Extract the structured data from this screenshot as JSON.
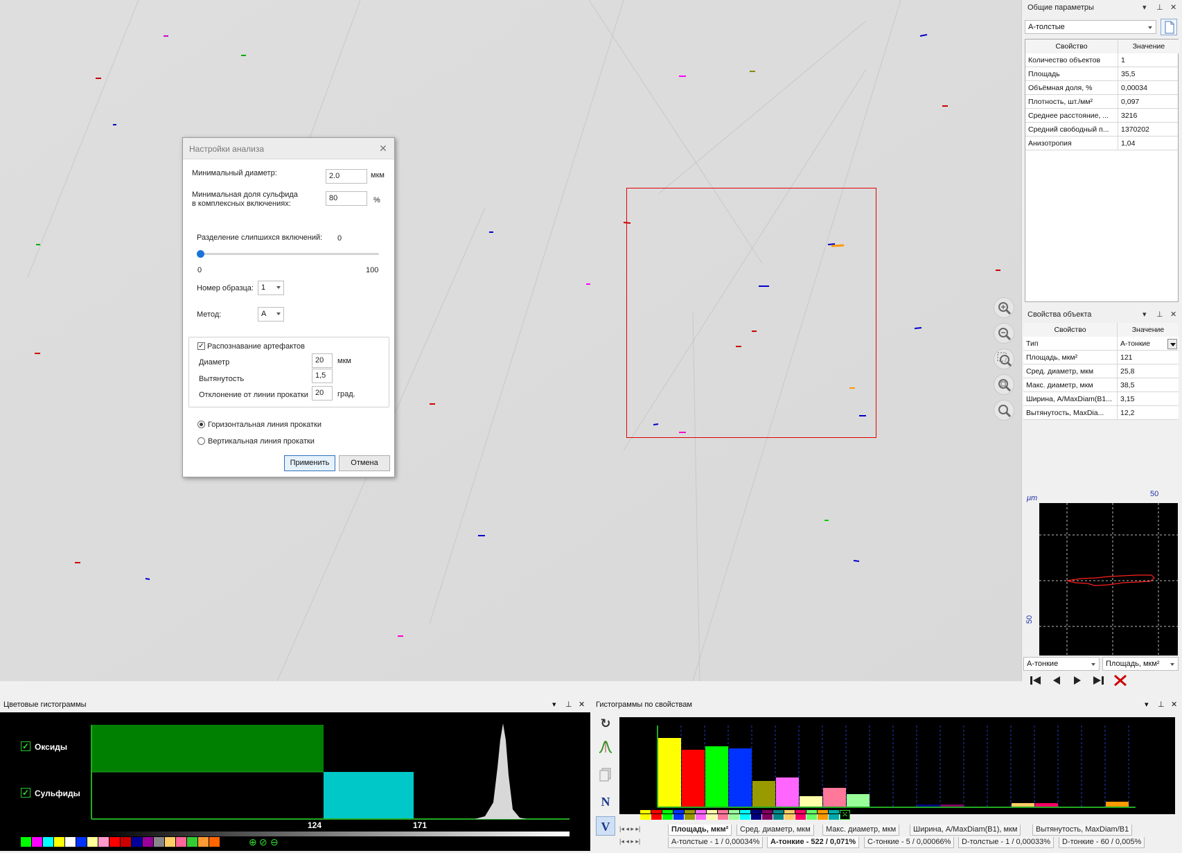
{
  "dialog": {
    "title": "Настройки анализа",
    "min_diameter_label": "Минимальный диаметр:",
    "min_diameter_value": "2.0",
    "min_diameter_unit": "мкм",
    "sulfide_fraction_label_1": "Минимальная доля сульфида",
    "sulfide_fraction_label_2": "в комплексных включениях:",
    "sulfide_fraction_value": "80",
    "sulfide_fraction_unit": "%",
    "separation_label": "Разделение слипшихся включений:",
    "separation_value": "0",
    "slider_min": "0",
    "slider_max": "100",
    "sample_label": "Номер образца:",
    "sample_value": "1",
    "method_label": "Метод:",
    "method_value": "A",
    "artifacts_label": "Распознавание артефактов",
    "artifacts_checked": true,
    "diameter_label": "Диаметр",
    "diameter_value": "20",
    "diameter_unit": "мкм",
    "elongation_label": "Вытянутость",
    "elongation_value": "1,5",
    "deviation_label": "Отклонение от линии прокатки",
    "deviation_value": "20",
    "deviation_unit": "град.",
    "radio_horizontal": "Горизонтальная линия прокатки",
    "radio_vertical": "Вертикальная линия прокатки",
    "selected_radio": "horizontal",
    "apply_label": "Применить",
    "cancel_label": "Отмена"
  },
  "general_params": {
    "title": "Общие параметры",
    "combo_value": "A-толстые",
    "col_property": "Свойство",
    "col_value": "Значение",
    "rows": [
      {
        "prop": "Количество объектов",
        "val": "1"
      },
      {
        "prop": "Площадь",
        "val": "35,5"
      },
      {
        "prop": "Объёмная доля, %",
        "val": "0,00034"
      },
      {
        "prop": "Плотность, шт./мм²",
        "val": "0,097"
      },
      {
        "prop": "Среднее расстояние, ...",
        "val": "3216"
      },
      {
        "prop": "Средний свободный п...",
        "val": "1370202"
      },
      {
        "prop": "Анизотропия",
        "val": "1,04"
      }
    ]
  },
  "object_props": {
    "title": "Свойства объекта",
    "col_property": "Свойство",
    "col_value": "Значение",
    "rows": [
      {
        "prop": "Тип",
        "val": "A-тонкие"
      },
      {
        "prop": "Площадь, мкм²",
        "val": "121"
      },
      {
        "prop": "Сред. диаметр, мкм",
        "val": "25,8"
      },
      {
        "prop": "Макс. диаметр, мкм",
        "val": "38,5"
      },
      {
        "prop": "Ширина, A/MaxDiam(B1...",
        "val": "3,15"
      },
      {
        "prop": "Вытянутость, MaxDia...",
        "val": "12,2"
      }
    ]
  },
  "shape_view": {
    "unit": "μm",
    "top_tick": "50",
    "left_tick": "50",
    "type_combo": "A-тонкие",
    "prop_combo": "Площадь, мкм²"
  },
  "color_hist": {
    "title": "Цветовые гистограммы",
    "oxides_label": "Оксиды",
    "sulfides_label": "Сульфиды",
    "threshold_1": "124",
    "threshold_2": "171",
    "oxide_color": "#008000",
    "sulfide_color": "#00c8c8"
  },
  "prop_hist": {
    "title": "Гистограммы по свойствам",
    "tabs": [
      "Площадь, мкм²",
      "Сред. диаметр, мкм",
      "Макс. диаметр, мкм",
      "Ширина, A/MaxDiam(B1), мкм",
      "Вытянутость, MaxDiam/B1"
    ],
    "class_tabs": [
      "A-толстые - 1 / 0,00034%",
      "A-тонкие - 522 / 0,071%",
      "C-тонкие - 5 / 0,00066%",
      "D-толстые - 1 / 0,00033%",
      "D-тонкие - 60 / 0,005%"
    ],
    "tool_n": "N",
    "tool_v": "V",
    "bars": [
      {
        "color": "#ffff00",
        "value": 1.0
      },
      {
        "color": "#ff0000",
        "value": 0.83
      },
      {
        "color": "#00ff00",
        "value": 0.88
      },
      {
        "color": "#0033ff",
        "value": 0.85
      },
      {
        "color": "#999900",
        "value": 0.38
      },
      {
        "color": "#ff66ff",
        "value": 0.43
      },
      {
        "color": "#ffffaa",
        "value": 0.16
      },
      {
        "color": "#ff7799",
        "value": 0.28
      },
      {
        "color": "#99ff99",
        "value": 0.19
      },
      {
        "color": "#ffffff",
        "value": 0.0
      },
      {
        "color": "#ffffff",
        "value": 0.0
      },
      {
        "color": "#000080",
        "value": 0.04
      },
      {
        "color": "#800060",
        "value": 0.04
      },
      {
        "color": "#ffffff",
        "value": 0.0
      },
      {
        "color": "#ffffff",
        "value": 0.0
      },
      {
        "color": "#ffcc66",
        "value": 0.06
      },
      {
        "color": "#ff0066",
        "value": 0.06
      },
      {
        "color": "#ffffff",
        "value": 0.0
      },
      {
        "color": "#ffffff",
        "value": 0.0
      },
      {
        "color": "#ff9900",
        "value": 0.08
      }
    ]
  },
  "palette_bottom_left": [
    "#00ff00",
    "#ff00ff",
    "#00ffff",
    "#ffff00",
    "#ffffff",
    "#0033ff",
    "#ffff99",
    "#ff99cc",
    "#ff0000",
    "#cc0000",
    "#000099",
    "#990099",
    "#888888",
    "#ffcc66",
    "#ff6699",
    "#33cc33",
    "#ff9933",
    "#ff6600"
  ],
  "palette_bottom_right": [
    "#ffff00",
    "#ff0000",
    "#00ff00",
    "#0033ff",
    "#999900",
    "#ff66ff",
    "#ffffaa",
    "#ff7799",
    "#99ff99",
    "#00ffff",
    "#000080",
    "#800060",
    "#008888",
    "#ffcc66",
    "#ff0066",
    "#66ff66",
    "#ff9900",
    "#00aaaa"
  ]
}
